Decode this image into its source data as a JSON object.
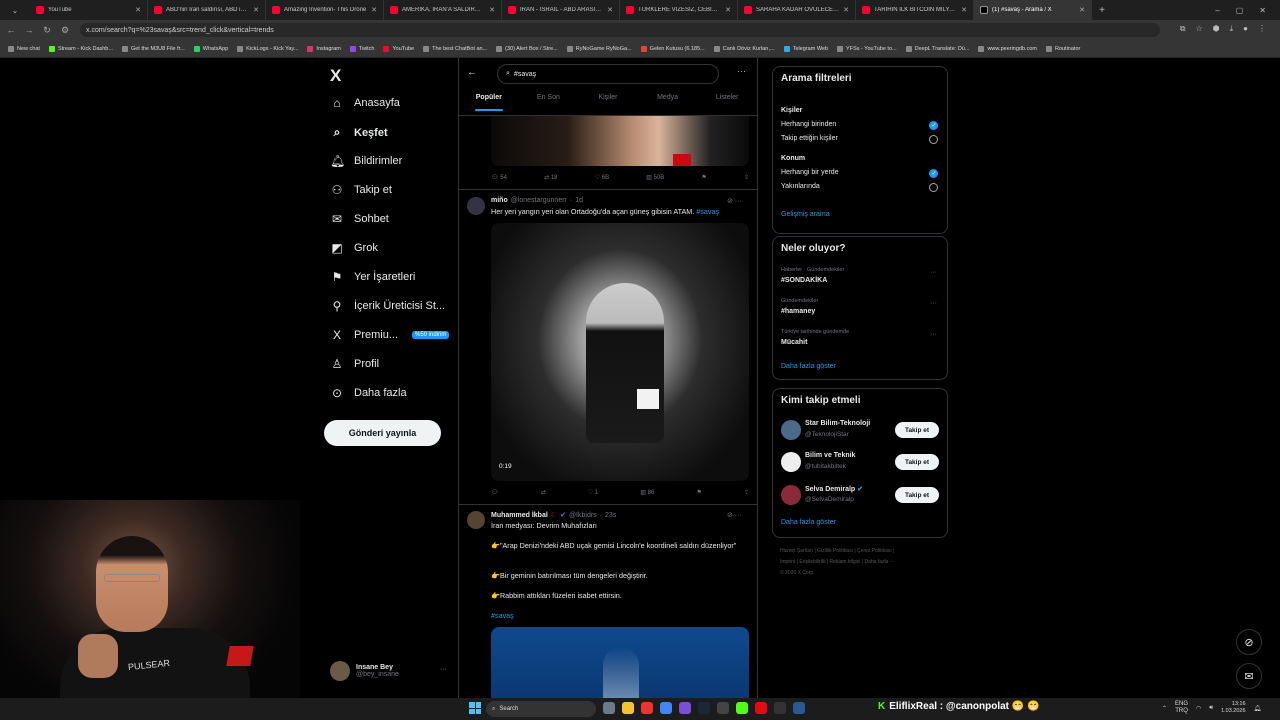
{
  "browser": {
    "tabs": [
      {
        "title": "YouTube"
      },
      {
        "title": "ABD'nin İran saldırısı, ABD için..."
      },
      {
        "title": "Amazing Invention- This Drone"
      },
      {
        "title": "AMERİKA, İRAN'A SALDIRDI | T..."
      },
      {
        "title": "İRAN - İSRAİL - ABD ARASINDA"
      },
      {
        "title": "TÜRKLERE VİZESİZ, CEBİNİZİ YO..."
      },
      {
        "title": "SARAHA KADAR ÖVÜLECEK OY..."
      },
      {
        "title": "TARİHİN İLK BITCOIN MİLYARD..."
      },
      {
        "title": "(1) #savaş - Arama / X",
        "active": true
      }
    ],
    "url": "x.com/search?q=%23savaş&src=trend_click&vertical=trends",
    "bookmarks": [
      "New chat",
      "Stream - Kick Dashb...",
      "Get the M3U8 File fr...",
      "WhatsApp",
      "KickLogs - Kick Yay...",
      "Instagram",
      "Twitch",
      "YouTube",
      "The best ChatBot an...",
      "(30) Alert Box / Stre...",
      "RyNoGame RyNoGa...",
      "Gelen Kutusu (6.185...",
      "Canlı Döviz Kurları,...",
      "Telegram Web",
      "YFSs - YouTube to...",
      "DeepL Translate: Dü...",
      "www.peeringdb.com",
      "Routinator"
    ]
  },
  "sidebar": {
    "logo": "X",
    "items": [
      {
        "label": "Anasayfa",
        "icon": "⌂"
      },
      {
        "label": "Keşfet",
        "icon": "⌕"
      },
      {
        "label": "Bildirimler",
        "icon": "🔔︎"
      },
      {
        "label": "Takip et",
        "icon": "⚇"
      },
      {
        "label": "Sohbet",
        "icon": "✉"
      },
      {
        "label": "Grok",
        "icon": "◩"
      },
      {
        "label": "Yer İşaretleri",
        "icon": "⚑"
      },
      {
        "label": "İçerik Üreticisi St...",
        "icon": "⚲"
      },
      {
        "label": "Premiu...",
        "icon": "X"
      },
      {
        "label": "Profil",
        "icon": "♙"
      },
      {
        "label": "Daha fazla",
        "icon": "⊙"
      }
    ],
    "premium_badge": "%50 indirim",
    "notif_count": "1",
    "post_button": "Gönderi yayınla",
    "profile": {
      "name": "Insane Bey",
      "handle": "@bey_insane",
      "more": "···"
    }
  },
  "search": {
    "query": "#savaş",
    "tabs": [
      "Popüler",
      "En Son",
      "Kişiler",
      "Medya",
      "Listeler"
    ]
  },
  "posts": [
    {
      "actions": {
        "reply": "54",
        "repost": "18",
        "like": "6B",
        "views": "50B"
      }
    },
    {
      "name": "miño",
      "handle": "@lonestargunnerr",
      "time": "1d",
      "text": "Her yeri yangın yeri olan Ortadoğu'da açan güneş gibisin ATAM.",
      "hashtag": "#savaş",
      "video_time": "0:19",
      "actions": {
        "reply": "",
        "repost": "",
        "like": "1",
        "views": "86"
      }
    },
    {
      "name": "Muhammed İkbal",
      "handle": "@Ikbidrs",
      "time": "23s",
      "line1": "İran medyası: Devrim Muhafızları",
      "line2": "👉\"Arap Denizi'ndeki ABD uçak gemisi Lincoln'e koordineli saldırı düzenliyor\"",
      "line3": "👉Bir geminin batırılması tüm dengeleri değiştirir.",
      "line4": "👉Rabbim attıkları füzeleri isabet ettirsin.",
      "hashtag": "#savaş"
    }
  ],
  "filters": {
    "title": "Arama filtreleri",
    "people_label": "Kişiler",
    "people_opt1": "Herhangi birinden",
    "people_opt2": "Takip ettiğin kişiler",
    "location_label": "Konum",
    "loc_opt1": "Herhangi bir yerde",
    "loc_opt2": "Yakınlarında",
    "advanced": "Gelişmiş arama"
  },
  "trends": {
    "title": "Neler oluyor?",
    "items": [
      {
        "context": "Haberler · Gündemdekiler",
        "name": "#SONDAKİKA"
      },
      {
        "context": "Gündemdekiler",
        "name": "#hamaney"
      },
      {
        "context": "Türkiye tarihinde gündemde",
        "name": "Mücahit"
      }
    ],
    "more": "Daha fazla göster"
  },
  "who": {
    "title": "Kimi takip etmeli",
    "items": [
      {
        "name": "Star Bilim-Teknoloji",
        "handle": "@TeknolojiStar",
        "button": "Takip et"
      },
      {
        "name": "Bilim ve Teknik",
        "handle": "@tubitakbiltek",
        "button": "Takip et"
      },
      {
        "name": "Selva Demiralp",
        "handle": "@SelvaDemiralp",
        "button": "Takip et"
      }
    ],
    "more": "Daha fazla göster"
  },
  "footer": {
    "line1": "Hizmet Şartları | Gizlilik Politikası | Çerez Politikası |",
    "line2": "Imprint | Erişilebilirlik | Reklam bilgisi | Daha fazla ···",
    "line3": "© 2026 X Corp."
  },
  "taskbar": {
    "search": "Search",
    "stream": "EliflixReal : @canonpolat 😁 😁",
    "lang1": "ENG",
    "lang2": "TRQ",
    "time": "13:16",
    "date": "1.03.2026"
  }
}
